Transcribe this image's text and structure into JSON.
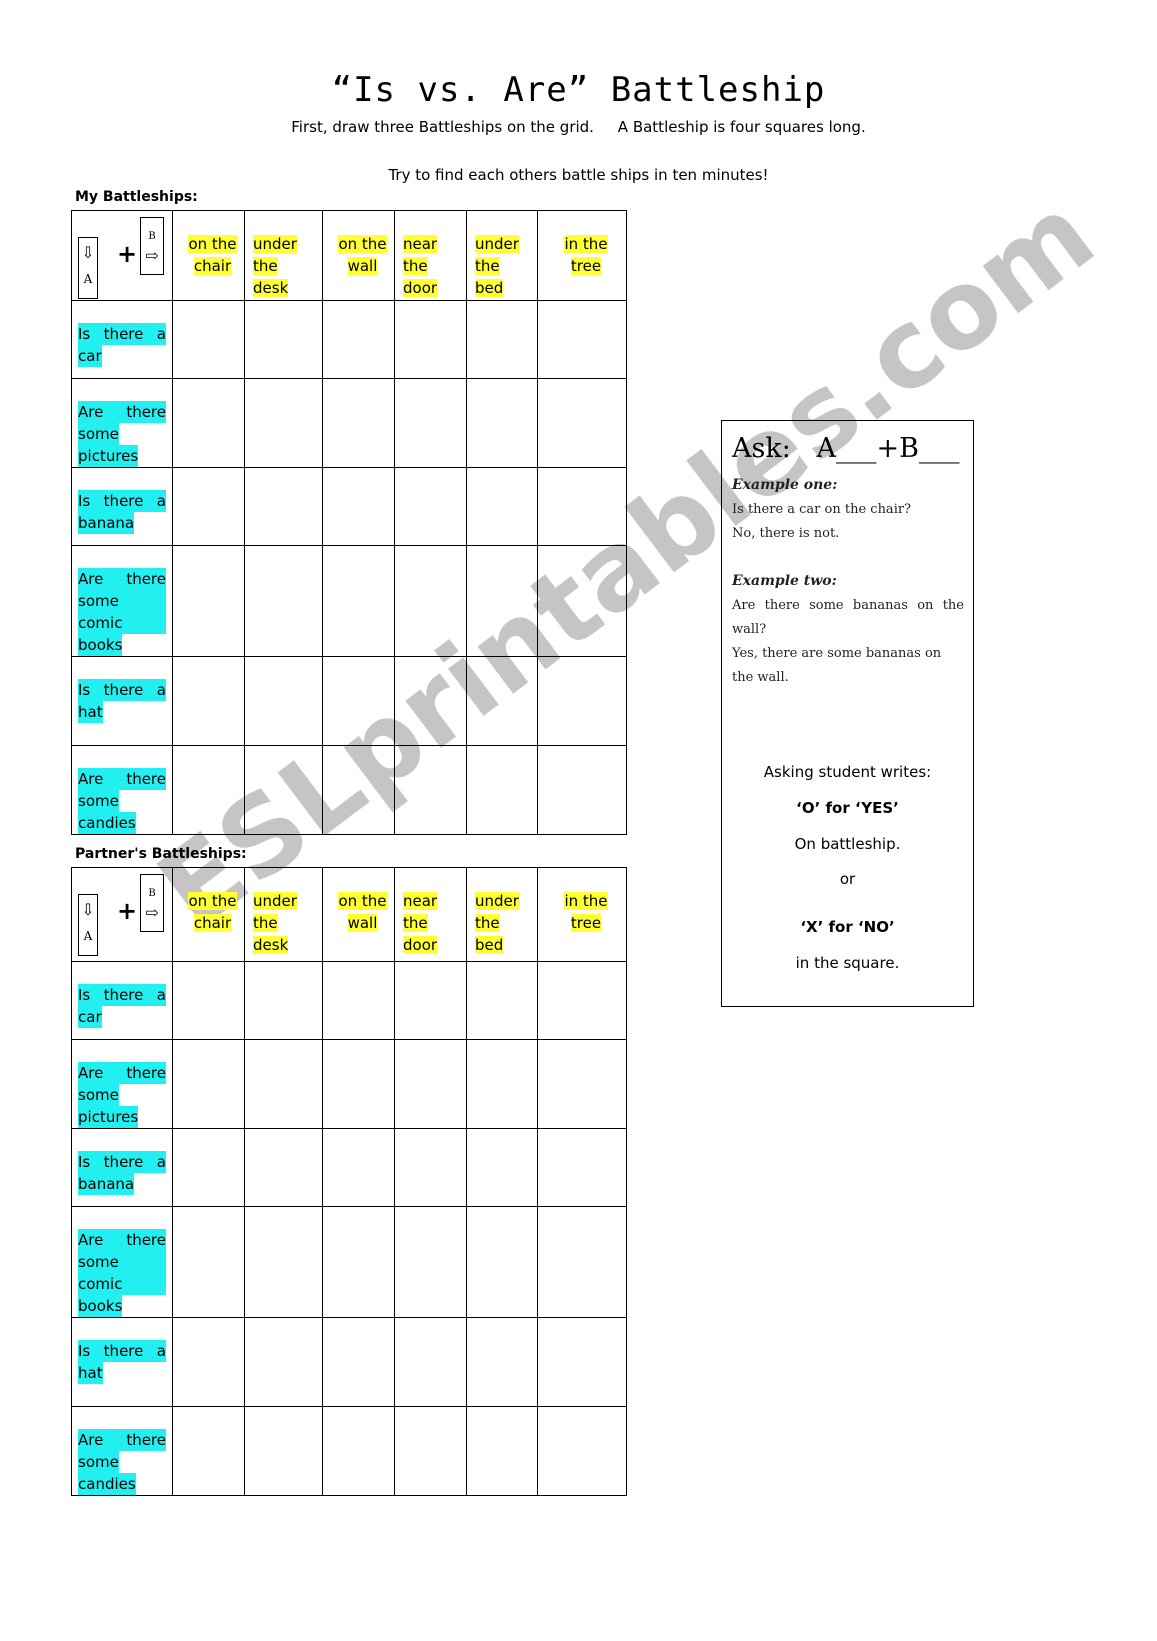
{
  "title": "“Is vs. Are” Battleship",
  "instructions": {
    "line1": "First, draw three Battleships on the grid.     A Battleship is four squares long.",
    "line2": "Try to find each others battle ships in ten minutes!"
  },
  "grids": [
    {
      "label": "My Battleships:"
    },
    {
      "label": "Partner's Battleships:"
    }
  ],
  "corner": {
    "a_label": "A",
    "b_label": "B",
    "plus": "+",
    "down_arrow": "⇩",
    "right_arrow": "⇨"
  },
  "columns": [
    [
      "on the",
      "chair"
    ],
    [
      "under",
      "the",
      "desk"
    ],
    [
      "on the",
      "wall"
    ],
    [
      "near",
      "the",
      "door"
    ],
    [
      "under",
      "the",
      "bed"
    ],
    [
      "in the",
      "tree"
    ]
  ],
  "rows": [
    [
      "Is there a",
      "car"
    ],
    [
      "Are there",
      "some",
      "pictures"
    ],
    [
      "Is there a",
      "banana"
    ],
    [
      "Are there",
      "some comic",
      "books"
    ],
    [
      "Is there a",
      "hat"
    ],
    [
      "Are there",
      "some",
      "candies"
    ]
  ],
  "ask_box": {
    "heading": "Ask:   A___+B___",
    "example1_title": "Example  one:",
    "example1_q": "Is there a car on the chair?",
    "example1_a": "No, there is not.",
    "example2_title": "Example  two:",
    "example2_q": "Are there some bananas on the wall?",
    "example2_a": "Yes, there are some bananas on the wall.",
    "writes": "Asking student writes:",
    "yes_line": "‘O’ for ‘YES’",
    "on_battleship": "On battleship.",
    "or": "or",
    "no_line": "‘X’ for ‘NO’",
    "in_square": "in the square."
  },
  "watermark": "ESLprintables.com",
  "colors": {
    "column_highlight": "#ffff33",
    "row_highlight": "#22f0f0"
  }
}
